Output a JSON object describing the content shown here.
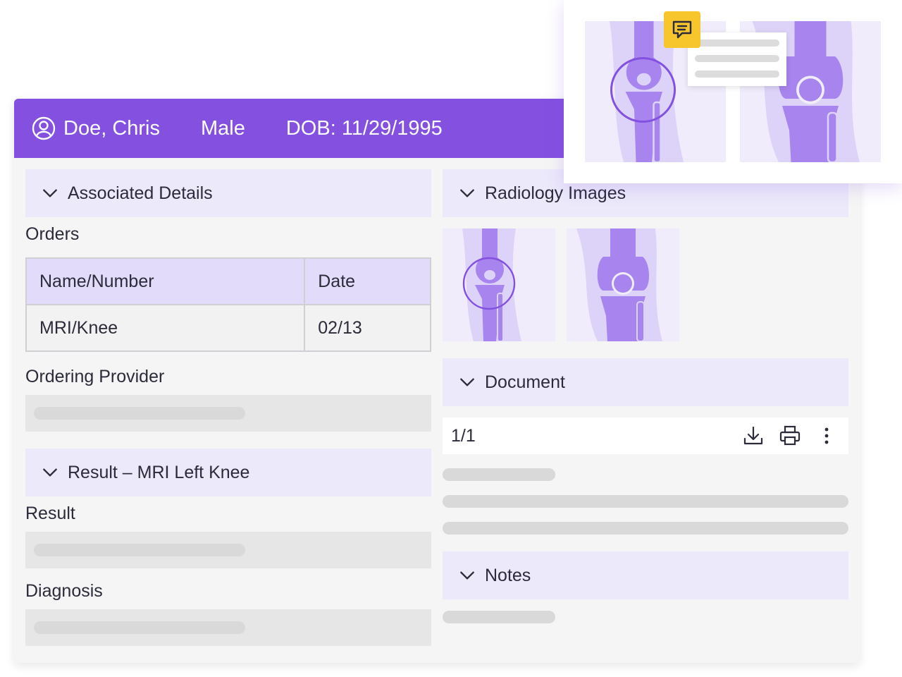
{
  "patient": {
    "name": "Doe, Chris",
    "sex": "Male",
    "dob": "DOB: 11/29/1995"
  },
  "left": {
    "associated_details": "Associated Details",
    "orders_label": "Orders",
    "orders_table": {
      "headers": [
        "Name/Number",
        "Date"
      ],
      "rows": [
        [
          "MRI/Knee",
          "02/13"
        ]
      ]
    },
    "ordering_provider_label": "Ordering Provider",
    "result_section": "Result – MRI Left Knee",
    "result_label": "Result",
    "diagnosis_label": "Diagnosis"
  },
  "right": {
    "radiology_images": "Radiology Images",
    "document": "Document",
    "page_indicator": "1/1",
    "notes": "Notes"
  },
  "icons": {
    "user": "user-circle-icon",
    "chevron": "chevron-down-icon",
    "download": "download-icon",
    "print": "print-icon",
    "more": "more-vertical-icon",
    "comment": "comment-icon"
  },
  "colors": {
    "accent": "#8350e0",
    "section_bg": "#ece9fb",
    "bone": "#a784ee",
    "comment_badge": "#f7c52c"
  }
}
